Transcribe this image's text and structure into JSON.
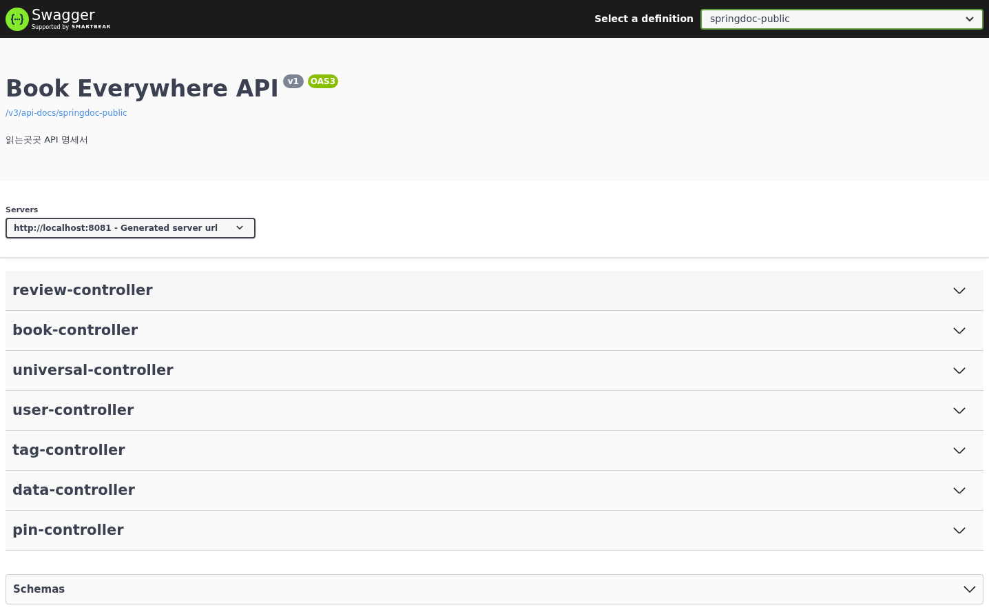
{
  "topbar": {
    "logo_text": "Swagger",
    "logo_subtext": "Supported by",
    "logo_brand": "SMARTBEAR",
    "definition_label": "Select a definition",
    "definition_value": "springdoc-public"
  },
  "info": {
    "title": "Book Everywhere API",
    "version": "v1",
    "spec": "OAS3",
    "url": "/v3/api-docs/springdoc-public",
    "description": "읽는곳곳 API 명세서"
  },
  "servers": {
    "label": "Servers",
    "value": "http://localhost:8081 - Generated server url"
  },
  "tags": [
    {
      "name": "review-controller",
      "expanded": false
    },
    {
      "name": "book-controller",
      "expanded": false
    },
    {
      "name": "universal-controller",
      "expanded": false
    },
    {
      "name": "user-controller",
      "expanded": false
    },
    {
      "name": "tag-controller",
      "expanded": false
    },
    {
      "name": "data-controller",
      "expanded": false
    },
    {
      "name": "pin-controller",
      "expanded": false
    }
  ],
  "schemas": {
    "label": "Schemas",
    "expanded": false
  }
}
